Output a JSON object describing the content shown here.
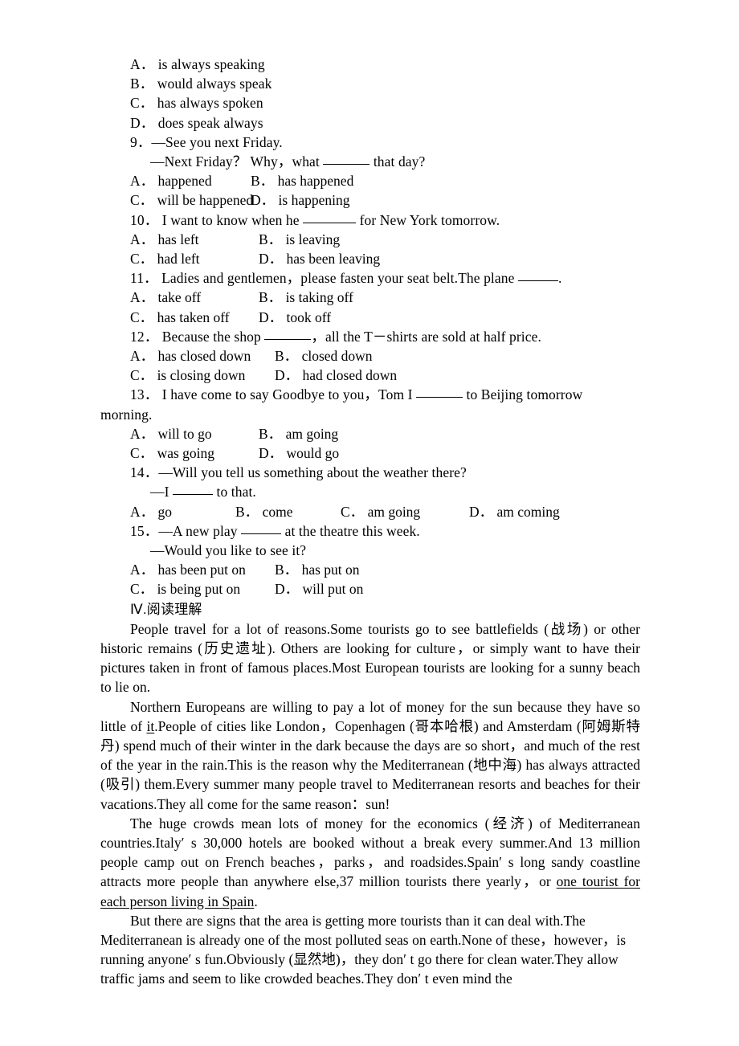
{
  "document": {
    "type": "english-exam-worksheet",
    "language": "English with Chinese glosses"
  },
  "questions": [
    {
      "id": "q8-options",
      "stem": null,
      "options": [
        {
          "label": "A．",
          "text": "is always speaking"
        },
        {
          "label": "B．",
          "text": "would always speak"
        },
        {
          "label": "C．",
          "text": "has always spoken"
        },
        {
          "label": "D．",
          "text": "does speak always"
        }
      ]
    },
    {
      "id": "q9",
      "number": "9．",
      "stem_line1": "—See you next Friday.",
      "stem_line2_a": "—Next Friday？ Why，what ",
      "stem_line2_b": " that day?",
      "options": [
        {
          "label": "A．",
          "text": "happened"
        },
        {
          "label": "B．",
          "text": "has happened"
        },
        {
          "label": "C．",
          "text": "will be happened"
        },
        {
          "label": "D．",
          "text": "is happening"
        }
      ]
    },
    {
      "id": "q10",
      "number": "10．",
      "stem_a": " I want to know when he ",
      "stem_b": " for New York tomorrow.",
      "options": [
        {
          "label": "A．",
          "text": "has left"
        },
        {
          "label": "B．",
          "text": "is leaving"
        },
        {
          "label": "C．",
          "text": "had left"
        },
        {
          "label": "D．",
          "text": "has been leaving"
        }
      ]
    },
    {
      "id": "q11",
      "number": "11．",
      "stem_a": " Ladies and gentlemen，please fasten your seat belt.The plane ",
      "stem_b": ".",
      "options": [
        {
          "label": "A．",
          "text": "take off"
        },
        {
          "label": "B．",
          "text": "is taking off"
        },
        {
          "label": "C．",
          "text": "has taken off"
        },
        {
          "label": "D．",
          "text": "took off"
        }
      ]
    },
    {
      "id": "q12",
      "number": "12．",
      "stem_a": " Because the shop ",
      "stem_b": "，all the T－shirts are sold at half price.",
      "options": [
        {
          "label": "A．",
          "text": "has closed down"
        },
        {
          "label": "B．",
          "text": "closed down"
        },
        {
          "label": "C．",
          "text": "is closing down"
        },
        {
          "label": "D．",
          "text": "had closed down"
        }
      ]
    },
    {
      "id": "q13",
      "number": "13．",
      "stem_a": " I have come to say Goodbye to you，Tom I ",
      "stem_b": " to Beijing tomorrow",
      "stem_wrap": "morning.",
      "options": [
        {
          "label": "A．",
          "text": "will to go"
        },
        {
          "label": "B．",
          "text": "am going"
        },
        {
          "label": "C．",
          "text": "was going"
        },
        {
          "label": "D．",
          "text": "would go"
        }
      ]
    },
    {
      "id": "q14",
      "number": "14．",
      "stem_line1": "—Will you tell us something about the weather there?",
      "stem_line2_a": "—I ",
      "stem_line2_b": " to that.",
      "options": [
        {
          "label": "A．",
          "text": "go"
        },
        {
          "label": "B．",
          "text": "come"
        },
        {
          "label": "C．",
          "text": "am going"
        },
        {
          "label": "D．",
          "text": "am coming"
        }
      ]
    },
    {
      "id": "q15",
      "number": "15．",
      "stem_line1_a": "—A new play ",
      "stem_line1_b": " at the theatre this week.",
      "stem_line2": "—Would you like to see it?",
      "options": [
        {
          "label": "A．",
          "text": "has been put on"
        },
        {
          "label": "B．",
          "text": "has put on"
        },
        {
          "label": "C．",
          "text": "is being put on"
        },
        {
          "label": "D．",
          "text": "will put on"
        }
      ]
    }
  ],
  "section": {
    "heading": "Ⅳ.阅读理解"
  },
  "passage": {
    "paragraphs": [
      {
        "id": "p1",
        "text": "People travel for a lot of reasons.Some tourists go to see battlefields (战场) or other historic remains (历史遗址). Others are looking for culture，or simply want to have their pictures taken in front of famous places.Most European tourists are looking for a sunny beach to lie on."
      },
      {
        "id": "p2",
        "parts": [
          {
            "kind": "text",
            "text": "Northern Europeans are willing to pay a lot of money for the sun because they have so little of "
          },
          {
            "kind": "underline",
            "text": "it"
          },
          {
            "kind": "text",
            "text": ".People of cities like London，Copenhagen (哥本哈根) and Amsterdam (阿姆斯特丹) spend much of their winter in the dark because the days are so short，and much of the rest of the year in the rain.This is the reason why the Mediterranean (地中海) has always attracted (吸引) them.Every summer many people travel to Mediterranean resorts and beaches for their vacations.They all come for the same reason：sun!"
          }
        ]
      },
      {
        "id": "p3",
        "parts": [
          {
            "kind": "text",
            "text": "The huge crowds mean lots of money for the economics (经济) of Mediterranean countries.Italy′ s 30,000 hotels are booked without a break every summer.And 13 million people camp out on French beaches，parks，and roadsides.Spain′ s long sandy coastline attracts more people than anywhere else,37 million tourists there yearly，or "
          },
          {
            "kind": "underline",
            "text": "one tourist for each person living in Spain"
          },
          {
            "kind": "text",
            "text": "."
          }
        ]
      },
      {
        "id": "p4",
        "text": "But there are signs that the area is getting more tourists than it can deal with.The Mediterranean is already one of the most polluted seas on earth.None of these，however，is running anyone′ s fun.Obviously (显然地)，they don′ t go there for clean water.They allow traffic jams and seem to like crowded beaches.They don′ t even mind the"
      }
    ]
  }
}
